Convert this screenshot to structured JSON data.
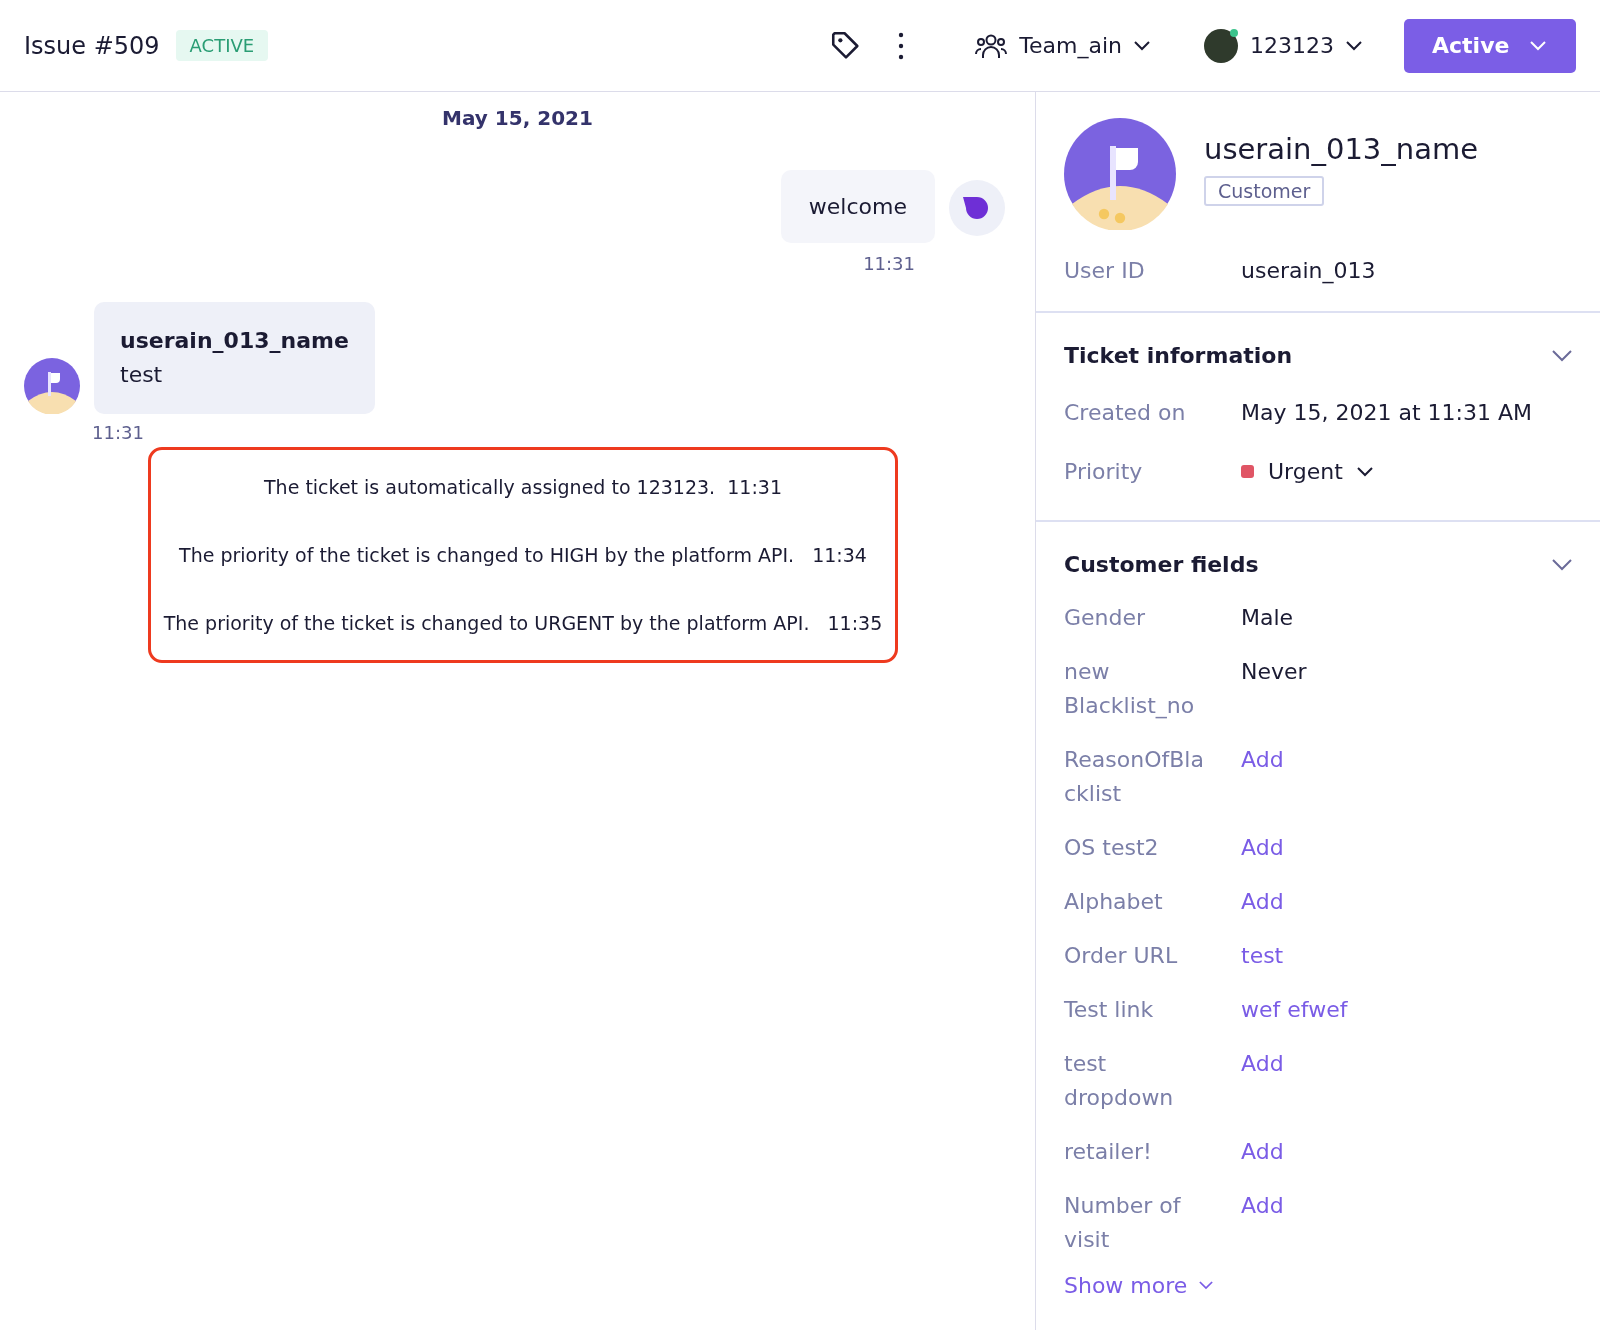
{
  "header": {
    "title": "Issue #509",
    "status": "ACTIVE",
    "team": "Team_ain",
    "agent": "123123",
    "status_button": "Active"
  },
  "chat": {
    "date": "May 15, 2021",
    "messages": [
      {
        "kind": "outgoing",
        "text": "welcome",
        "time": "11:31"
      },
      {
        "kind": "incoming",
        "sender": "userain_013_name",
        "text": "test",
        "time": "11:31"
      }
    ],
    "events": [
      "The ticket is automatically assigned to 123123.  11:31",
      "The priority of the ticket is changed to HIGH by the platform API.   11:34",
      "The priority of the ticket is changed to URGENT by the platform API.   11:35"
    ]
  },
  "profile": {
    "name": "userain_013_name",
    "role": "Customer",
    "user_id_label": "User ID",
    "user_id": "userain_013"
  },
  "ticket_info": {
    "title": "Ticket information",
    "expanded": true,
    "created_label": "Created on",
    "created": "May 15, 2021 at 11:31 AM",
    "priority_label": "Priority",
    "priority": {
      "label": "Urgent",
      "color": "#e05565"
    }
  },
  "customer_fields": {
    "title": "Customer fields",
    "expanded": true,
    "fields": [
      {
        "label": "Gender",
        "value": "Male",
        "kind": "text"
      },
      {
        "label": "new Blacklist_no",
        "value": "Never",
        "kind": "text"
      },
      {
        "label": "ReasonOfBlacklist",
        "value": "Add",
        "kind": "link"
      },
      {
        "label": "OS test2",
        "value": "Add",
        "kind": "link"
      },
      {
        "label": "Alphabet",
        "value": "Add",
        "kind": "link"
      },
      {
        "label": "Order URL",
        "value": "test",
        "kind": "link"
      },
      {
        "label": "Test link",
        "value": "wef efwef",
        "kind": "link"
      },
      {
        "label": "test dropdown",
        "value": "Add",
        "kind": "link"
      },
      {
        "label": "retailer!",
        "value": "Add",
        "kind": "link"
      },
      {
        "label": "Number of visit",
        "value": "Add",
        "kind": "link"
      }
    ],
    "show_more": "Show more"
  }
}
